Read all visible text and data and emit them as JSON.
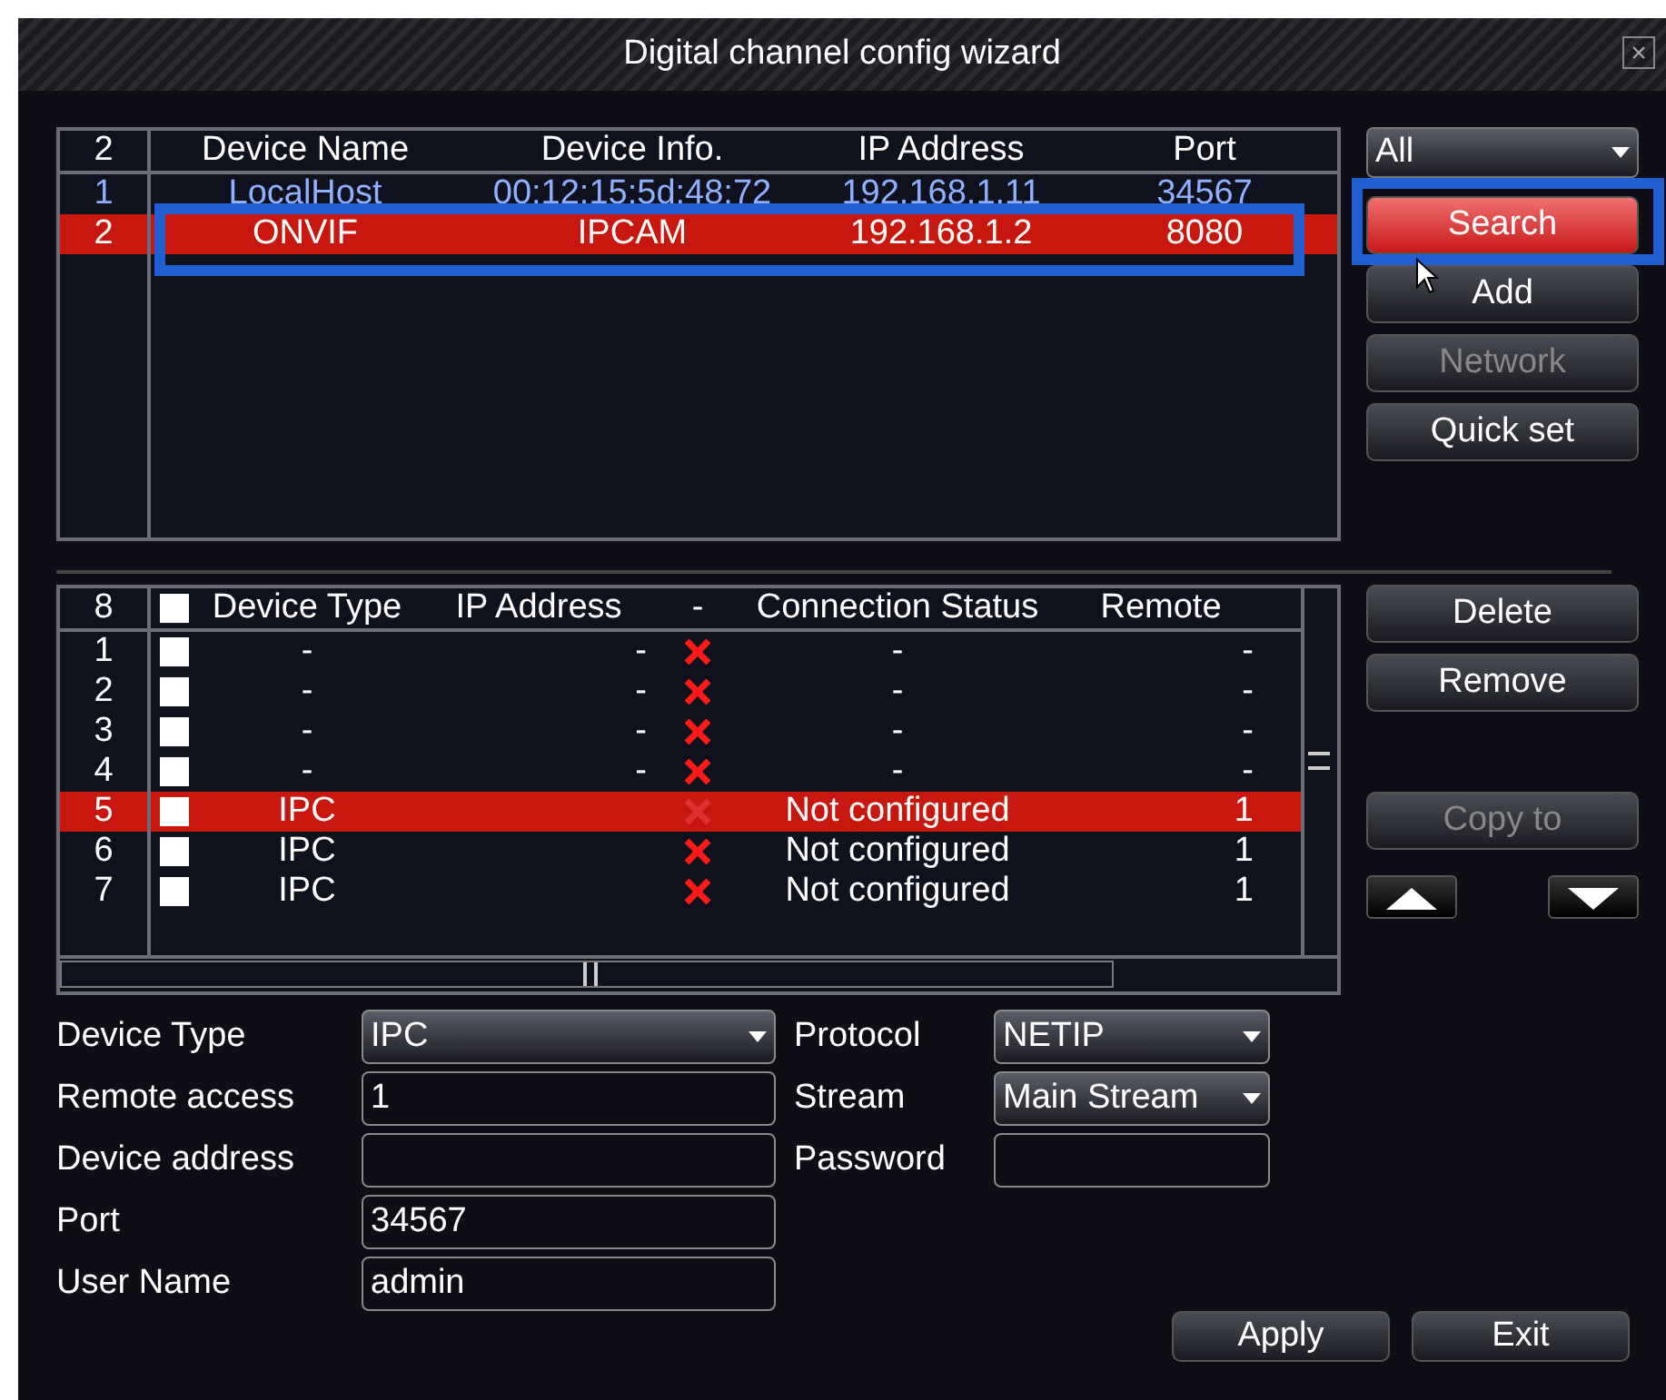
{
  "window": {
    "title": "Digital channel config wizard",
    "close_label": "×"
  },
  "device_list": {
    "columns": [
      "2",
      "Device Name",
      "Device Info.",
      "IP Address",
      "Port"
    ],
    "rows": [
      {
        "cells": [
          "1",
          "LocalHost",
          "00:12:15:5d:48:72",
          "192.168.1.11",
          "34567"
        ],
        "selected": false,
        "highlighted": false
      },
      {
        "cells": [
          "2",
          "ONVIF",
          "IPCAM",
          "192.168.1.2",
          "8080"
        ],
        "selected": true,
        "highlighted": true
      }
    ]
  },
  "filter": {
    "value": "All"
  },
  "search_buttons": [
    {
      "label": "Search",
      "selected": true,
      "highlighted": true,
      "disabled": false
    },
    {
      "label": "Add",
      "selected": false,
      "highlighted": false,
      "disabled": false
    },
    {
      "label": "Network",
      "selected": false,
      "highlighted": false,
      "disabled": true
    },
    {
      "label": "Quick set",
      "selected": false,
      "highlighted": false,
      "disabled": false
    }
  ],
  "channel_list": {
    "select_all_checked": false,
    "columns": [
      "8",
      "Device Type",
      "IP Address",
      "-",
      "Connection Status",
      "Remote"
    ],
    "rows": [
      {
        "number": "1",
        "checked": false,
        "type": "-",
        "ip": "-",
        "connected": false,
        "status": "-",
        "remote": "-",
        "selected": false
      },
      {
        "number": "2",
        "checked": false,
        "type": "-",
        "ip": "-",
        "connected": false,
        "status": "-",
        "remote": "-",
        "selected": false
      },
      {
        "number": "3",
        "checked": false,
        "type": "-",
        "ip": "-",
        "connected": false,
        "status": "-",
        "remote": "-",
        "selected": false
      },
      {
        "number": "4",
        "checked": false,
        "type": "-",
        "ip": "-",
        "connected": false,
        "status": "-",
        "remote": "-",
        "selected": false
      },
      {
        "number": "5",
        "checked": false,
        "type": "IPC",
        "connected": false,
        "status": "Not configured",
        "remote": "1",
        "selected": true
      },
      {
        "number": "6",
        "checked": false,
        "type": "IPC",
        "connected": false,
        "status": "Not configured",
        "remote": "1",
        "selected": false
      },
      {
        "number": "7",
        "checked": false,
        "type": "IPC",
        "connected": false,
        "status": "Not configured",
        "remote": "1",
        "selected": false
      }
    ]
  },
  "channel_buttons": [
    {
      "label": "Delete",
      "disabled": false
    },
    {
      "label": "Remove",
      "disabled": false
    },
    {
      "label": "Copy to",
      "disabled": true
    }
  ],
  "form": {
    "left": [
      {
        "label": "Device Type",
        "kind": "select",
        "value": "IPC"
      },
      {
        "label": "Remote access",
        "kind": "input",
        "value": "1"
      },
      {
        "label": "Device address",
        "kind": "input"
      },
      {
        "label": "Port",
        "kind": "input",
        "value": "34567"
      },
      {
        "label": "User Name",
        "kind": "input",
        "value": "admin"
      }
    ],
    "right": [
      {
        "label": "Protocol",
        "kind": "select",
        "value": "NETIP"
      },
      {
        "label": "Stream",
        "kind": "select",
        "value": "Main Stream"
      },
      {
        "label": "Password",
        "kind": "input"
      }
    ]
  },
  "footer_buttons": [
    "Apply",
    "Exit"
  ]
}
